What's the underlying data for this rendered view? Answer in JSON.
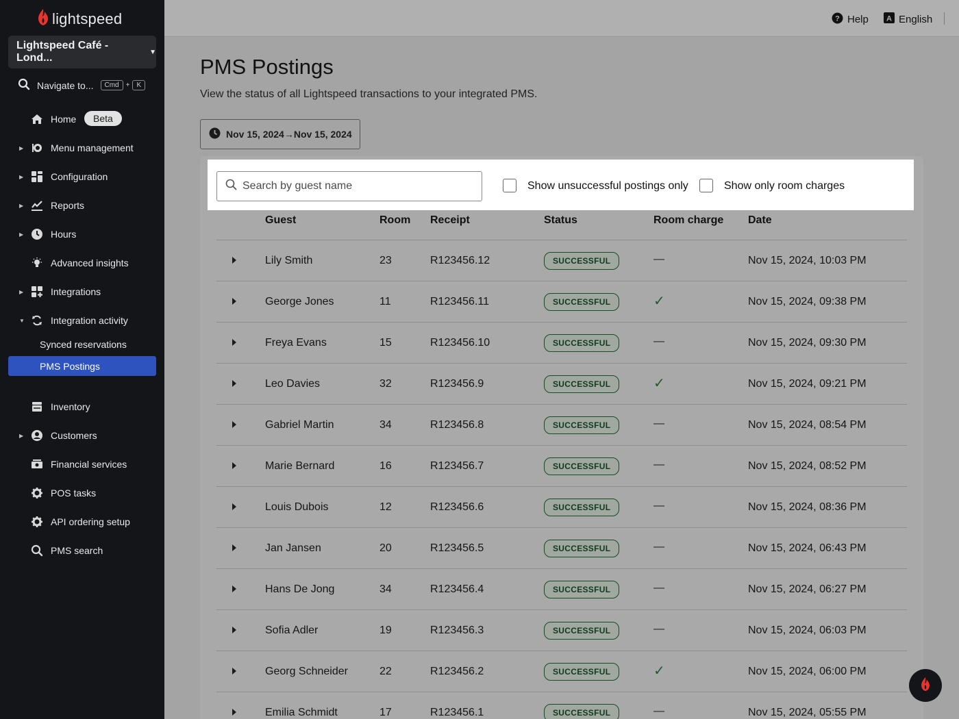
{
  "brand": {
    "logo_text": "lightspeed",
    "accent": "#e8352d"
  },
  "sidebar": {
    "store_name": "Lightspeed Café - Lond...",
    "nav_search": {
      "label": "Navigate to...",
      "key1": "Cmd",
      "plus": "+",
      "key2": "K"
    },
    "home": {
      "label": "Home",
      "badge": "Beta"
    },
    "items": [
      {
        "label": "Menu management",
        "icon": "menu-icon"
      },
      {
        "label": "Configuration",
        "icon": "config-icon"
      },
      {
        "label": "Reports",
        "icon": "reports-icon"
      },
      {
        "label": "Hours",
        "icon": "clock-icon"
      },
      {
        "label": "Advanced insights",
        "icon": "bulb-icon"
      },
      {
        "label": "Integrations",
        "icon": "integrations-icon"
      },
      {
        "label": "Integration activity",
        "icon": "sync-icon"
      },
      {
        "label": "Inventory",
        "icon": "inventory-icon"
      },
      {
        "label": "Customers",
        "icon": "customers-icon"
      },
      {
        "label": "Financial services",
        "icon": "cash-icon"
      },
      {
        "label": "POS tasks",
        "icon": "gear-icon"
      },
      {
        "label": "API ordering setup",
        "icon": "gear-icon"
      },
      {
        "label": "PMS search",
        "icon": "search-icon"
      }
    ],
    "sub_items": {
      "synced": "Synced reservations",
      "pms": "PMS Postings"
    }
  },
  "topbar": {
    "help": "Help",
    "language": "English",
    "language_badge": "A"
  },
  "page": {
    "title": "PMS Postings",
    "subtitle": "View the status of all Lightspeed transactions to your integrated PMS.",
    "date_range": "Nov 15, 2024→Nov 15, 2024"
  },
  "filters": {
    "search_placeholder": "Search by guest name",
    "unsuccessful_label": "Show unsuccessful postings only",
    "room_charges_label": "Show only room charges"
  },
  "table": {
    "columns": [
      "Guest",
      "Room",
      "Receipt",
      "Status",
      "Room charge",
      "Date"
    ],
    "rows": [
      {
        "guest": "Lily Smith",
        "room": "23",
        "receipt": "R123456.12",
        "status": "SUCCESSFUL",
        "room_charge": "—",
        "date": "Nov 15, 2024, 10:03 PM"
      },
      {
        "guest": "George Jones",
        "room": "11",
        "receipt": "R123456.11",
        "status": "SUCCESSFUL",
        "room_charge": "✓",
        "date": "Nov 15, 2024, 09:38 PM"
      },
      {
        "guest": "Freya Evans",
        "room": "15",
        "receipt": "R123456.10",
        "status": "SUCCESSFUL",
        "room_charge": "—",
        "date": "Nov 15, 2024, 09:30 PM"
      },
      {
        "guest": "Leo Davies",
        "room": "32",
        "receipt": "R123456.9",
        "status": "SUCCESSFUL",
        "room_charge": "✓",
        "date": "Nov 15, 2024, 09:21 PM"
      },
      {
        "guest": "Gabriel Martin",
        "room": "34",
        "receipt": "R123456.8",
        "status": "SUCCESSFUL",
        "room_charge": "—",
        "date": "Nov 15, 2024, 08:54 PM"
      },
      {
        "guest": "Marie Bernard",
        "room": "16",
        "receipt": "R123456.7",
        "status": "SUCCESSFUL",
        "room_charge": "—",
        "date": "Nov 15, 2024, 08:52 PM"
      },
      {
        "guest": "Louis Dubois",
        "room": "12",
        "receipt": "R123456.6",
        "status": "SUCCESSFUL",
        "room_charge": "—",
        "date": "Nov 15, 2024, 08:36 PM"
      },
      {
        "guest": "Jan Jansen",
        "room": "20",
        "receipt": "R123456.5",
        "status": "SUCCESSFUL",
        "room_charge": "—",
        "date": "Nov 15, 2024, 06:43 PM"
      },
      {
        "guest": "Hans De Jong",
        "room": "34",
        "receipt": "R123456.4",
        "status": "SUCCESSFUL",
        "room_charge": "—",
        "date": "Nov 15, 2024, 06:27 PM"
      },
      {
        "guest": "Sofia Adler",
        "room": "19",
        "receipt": "R123456.3",
        "status": "SUCCESSFUL",
        "room_charge": "—",
        "date": "Nov 15, 2024, 06:03 PM"
      },
      {
        "guest": "Georg Schneider",
        "room": "22",
        "receipt": "R123456.2",
        "status": "SUCCESSFUL",
        "room_charge": "✓",
        "date": "Nov 15, 2024, 06:00 PM"
      },
      {
        "guest": "Emilia Schmidt",
        "room": "17",
        "receipt": "R123456.1",
        "status": "SUCCESSFUL",
        "room_charge": "—",
        "date": "Nov 15, 2024, 05:55 PM"
      }
    ]
  }
}
